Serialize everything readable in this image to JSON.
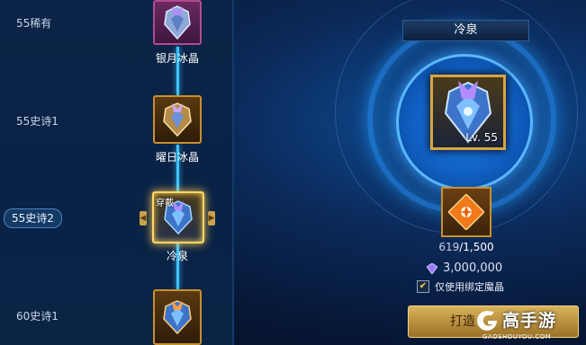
{
  "tiers": [
    {
      "label": "55稀有",
      "active": false
    },
    {
      "label": "55史诗1",
      "active": false
    },
    {
      "label": "55史诗2",
      "active": true
    },
    {
      "label": "60史诗1",
      "active": false
    }
  ],
  "items": [
    {
      "name": "银月冰晶",
      "frame": "purple"
    },
    {
      "name": "曜日冰晶",
      "frame": "gold"
    },
    {
      "name": "冷泉",
      "frame": "gold",
      "selected": true,
      "tag": "穿戴"
    },
    {
      "name": "",
      "frame": "gold"
    }
  ],
  "detail": {
    "title": "冷泉",
    "level": "Lv. 55",
    "material_have": "619",
    "material_need": "/1,500",
    "cost": "3,000,000",
    "checkbox_label": "仅使用绑定魔晶",
    "checkbox_checked": true,
    "forge_button": "打造"
  },
  "watermark": {
    "name": "高手游",
    "url": "GAOSHOUYOU.COM"
  },
  "colors": {
    "accent": "#3fc3ff",
    "gold": "#d9a441",
    "purple_frame": "#b24a8e"
  },
  "icons": [
    "crystal-crest-icon",
    "puzzle-material-icon",
    "gem-icon",
    "check-icon",
    "arrow-left-icon",
    "arrow-right-icon"
  ]
}
